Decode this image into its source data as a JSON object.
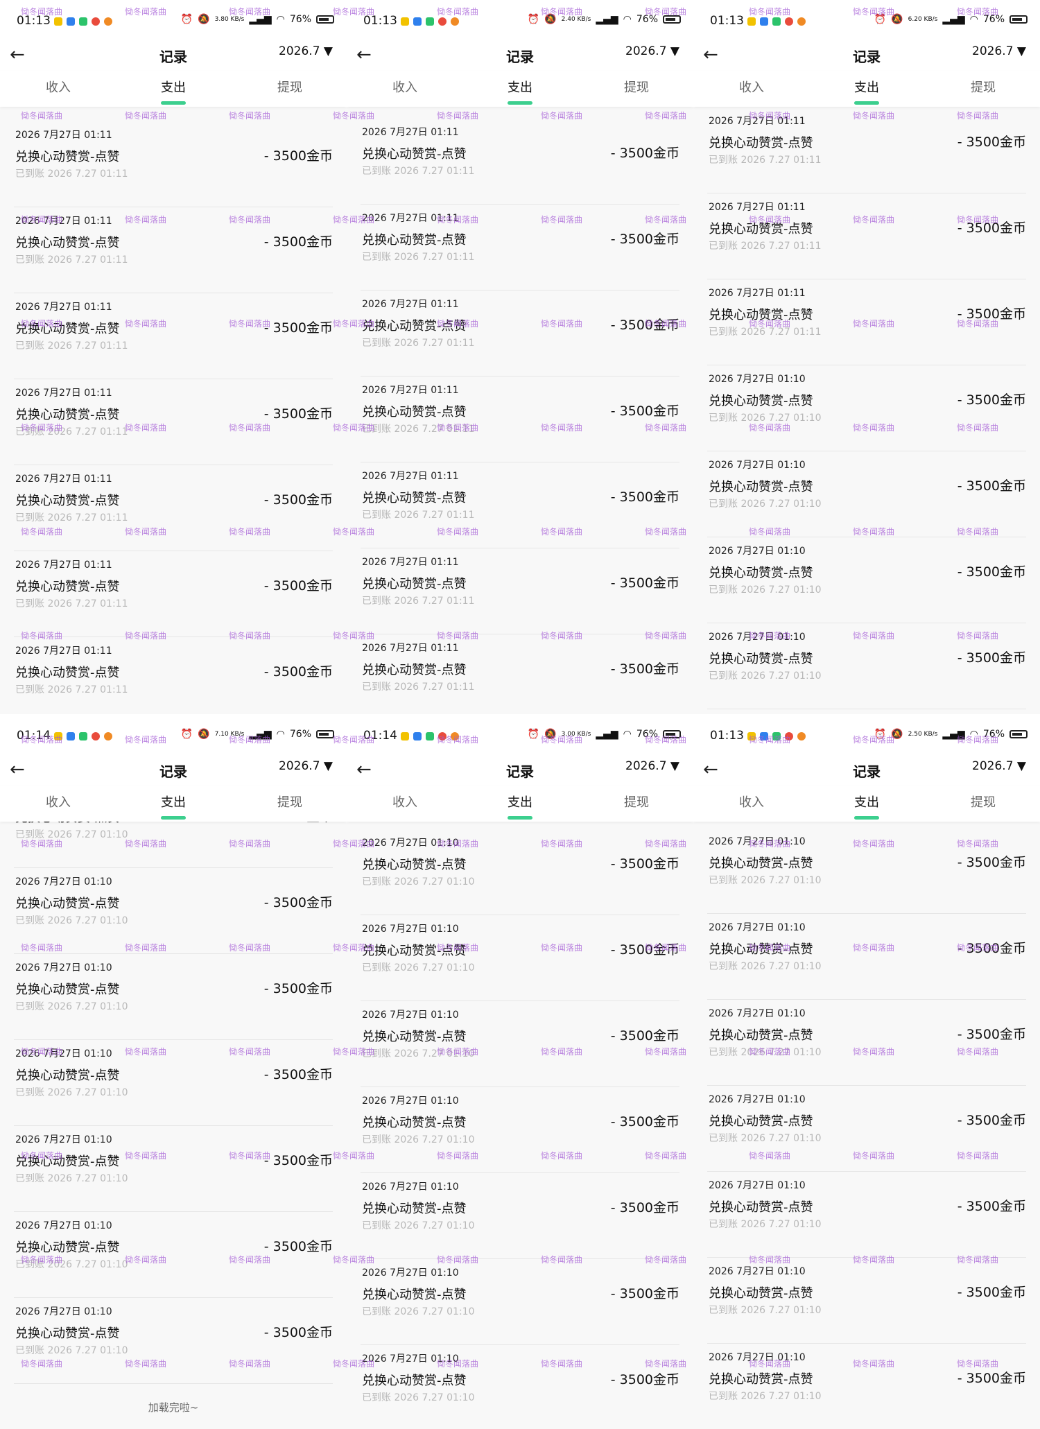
{
  "watermark": "恸冬闻落曲",
  "footer_text": "加载完啦~",
  "common": {
    "title": "记录",
    "back_icon": "←",
    "month": "2026.7",
    "tabs": [
      "收入",
      "支出",
      "提现"
    ],
    "active_tab": 1,
    "battery": "76%",
    "item_name": "兑换心动赞赏-点赞",
    "item_amount": "- 3500金币"
  },
  "accent_color": "#3ccf8e",
  "panels": [
    {
      "time": "01:13",
      "net_speed": "3.80 KB/s",
      "rows": [
        {
          "date": "2026 7月27日 01:11",
          "status": "已到账 2026 7.27 01:11"
        },
        {
          "date": "2026 7月27日 01:11",
          "status": "已到账 2026 7.27 01:11"
        },
        {
          "date": "2026 7月27日 01:11",
          "status": "已到账 2026 7.27 01:11"
        },
        {
          "date": "2026 7月27日 01:11",
          "status": "已到账 2026 7.27 01:11"
        },
        {
          "date": "2026 7月27日 01:11",
          "status": "已到账 2026 7.27 01:11"
        },
        {
          "date": "2026 7月27日 01:11",
          "status": "已到账 2026 7.27 01:11"
        },
        {
          "date": "2026 7月27日 01:11",
          "status": "已到账 2026 7.27 01:11"
        }
      ]
    },
    {
      "time": "01:13",
      "net_speed": "2.40 KB/s",
      "rows": [
        {
          "date": "2026 7月27日 01:11",
          "status": "已到账 2026 7.27 01:11"
        },
        {
          "date": "2026 7月27日 01:11",
          "status": "已到账 2026 7.27 01:11"
        },
        {
          "date": "2026 7月27日 01:11",
          "status": "已到账 2026 7.27 01:11"
        },
        {
          "date": "2026 7月27日 01:11",
          "status": "已到账 2026 7.27 01:11"
        },
        {
          "date": "2026 7月27日 01:11",
          "status": "已到账 2026 7.27 01:11"
        },
        {
          "date": "2026 7月27日 01:11",
          "status": "已到账 2026 7.27 01:11"
        },
        {
          "date": "2026 7月27日 01:11",
          "status": "已到账 2026 7.27 01:11"
        }
      ]
    },
    {
      "time": "01:13",
      "net_speed": "6.20 KB/s",
      "rows": [
        {
          "date": "2026 7月27日 01:11",
          "status": "已到账 2026 7.27 01:11"
        },
        {
          "date": "2026 7月27日 01:11",
          "status": "已到账 2026 7.27 01:11"
        },
        {
          "date": "2026 7月27日 01:11",
          "status": "已到账 2026 7.27 01:11"
        },
        {
          "date": "2026 7月27日 01:10",
          "status": "已到账 2026 7.27 01:10"
        },
        {
          "date": "2026 7月27日 01:10",
          "status": "已到账 2026 7.27 01:10"
        },
        {
          "date": "2026 7月27日 01:10",
          "status": "已到账 2026 7.27 01:10"
        },
        {
          "date": "2026 7月27日 01:10",
          "status": "已到账 2026 7.27 01:10"
        }
      ]
    },
    {
      "time": "01:14",
      "net_speed": "7.10 KB/s",
      "rows": [
        {
          "date": "",
          "status": "已到账 2026 7.27 01:10"
        },
        {
          "date": "2026 7月27日 01:10",
          "status": "已到账 2026 7.27 01:10"
        },
        {
          "date": "2026 7月27日 01:10",
          "status": "已到账 2026 7.27 01:10"
        },
        {
          "date": "2026 7月27日 01:10",
          "status": "已到账 2026 7.27 01:10"
        },
        {
          "date": "2026 7月27日 01:10",
          "status": "已到账 2026 7.27 01:10"
        },
        {
          "date": "2026 7月27日 01:10",
          "status": "已到账 2026 7.27 01:10"
        },
        {
          "date": "2026 7月27日 01:10",
          "status": "已到账 2026 7.27 01:10"
        }
      ]
    },
    {
      "time": "01:14",
      "net_speed": "3.00 KB/s",
      "rows": [
        {
          "date": "2026 7月27日 01:10",
          "status": "已到账 2026 7.27 01:10"
        },
        {
          "date": "2026 7月27日 01:10",
          "status": "已到账 2026 7.27 01:10"
        },
        {
          "date": "2026 7月27日 01:10",
          "status": "已到账 2026 7.27 01:10"
        },
        {
          "date": "2026 7月27日 01:10",
          "status": "已到账 2026 7.27 01:10"
        },
        {
          "date": "2026 7月27日 01:10",
          "status": "已到账 2026 7.27 01:10"
        },
        {
          "date": "2026 7月27日 01:10",
          "status": "已到账 2026 7.27 01:10"
        },
        {
          "date": "2026 7月27日 01:10",
          "status": "已到账 2026 7.27 01:10"
        }
      ]
    },
    {
      "time": "01:13",
      "net_speed": "2.50 KB/s",
      "rows": [
        {
          "date": "2026 7月27日 01:10",
          "status": "已到账 2026 7.27 01:10"
        },
        {
          "date": "2026 7月27日 01:10",
          "status": "已到账 2026 7.27 01:10"
        },
        {
          "date": "2026 7月27日 01:10",
          "status": "已到账 2026 7.27 01:10"
        },
        {
          "date": "2026 7月27日 01:10",
          "status": "已到账 2026 7.27 01:10"
        },
        {
          "date": "2026 7月27日 01:10",
          "status": "已到账 2026 7.27 01:10"
        },
        {
          "date": "2026 7月27日 01:10",
          "status": "已到账 2026 7.27 01:10"
        },
        {
          "date": "2026 7月27日 01:10",
          "status": "已到账 2026 7.27 01:10"
        }
      ]
    }
  ]
}
